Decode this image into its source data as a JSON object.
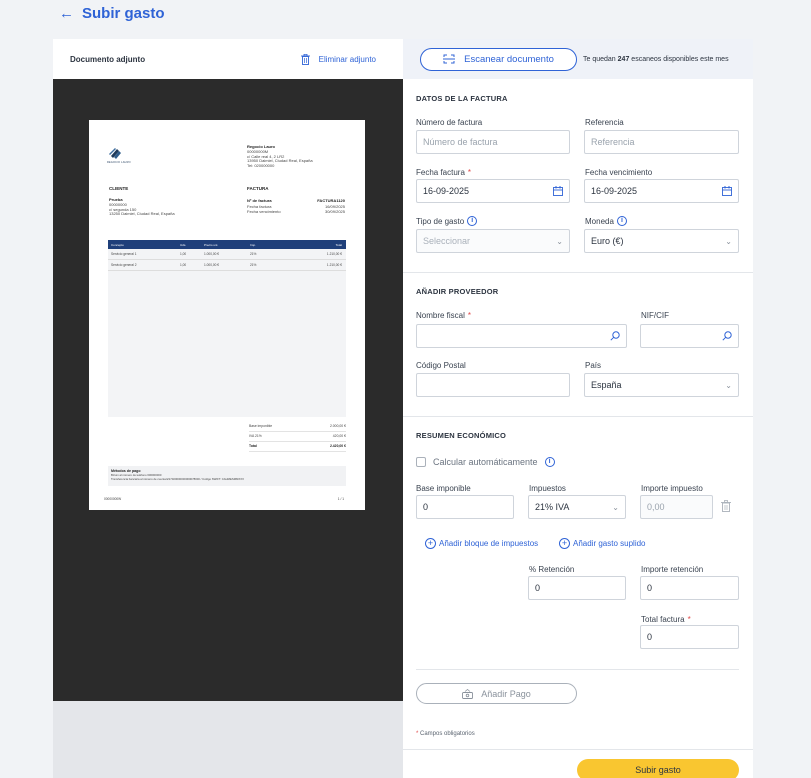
{
  "header": {
    "back_arrow": "←",
    "title": "Subir gasto"
  },
  "left": {
    "doc_label": "Documento adjunto",
    "remove_label": "Eliminar adjunto",
    "pdf": {
      "logo_text": "REGOCIO LAURO",
      "company_name": "Regocio Lauro",
      "company_lines": [
        "00000000M",
        "c/ Calle real 4, 2 LR2",
        "13950 Daimiel, Ciudad Real, España",
        "Tel: 020000000"
      ],
      "client_heading": "CLIENTE",
      "client_name": "Prueba",
      "client_lines": [
        "00000000",
        "c/ segunda 150",
        "13250 Daimiel, Ciudad Real, España"
      ],
      "invoice_heading": "FACTURA",
      "invoice_rows": [
        {
          "k": "Nº de factura",
          "v": "FACTURA1120"
        },
        {
          "k": "Fecha factura",
          "v": "16/09/2025"
        },
        {
          "k": "Fecha vencimiento",
          "v": "30/09/2025"
        }
      ],
      "table_headers": [
        "Concepto",
        "Uds.",
        "Precio uni.",
        "Imp.",
        "Total"
      ],
      "table_rows": [
        [
          "Servicio general 1",
          "1,00",
          "1.000,00 €",
          "21%",
          "1.210,00 €"
        ],
        [
          "Servicio general 2",
          "1,00",
          "1.000,00 €",
          "21%",
          "1.210,00 €"
        ]
      ],
      "totals": [
        {
          "k": "Base imponible",
          "v": "2.000,00 €"
        },
        {
          "k": "IVA 21%",
          "v": "420,00 €"
        },
        {
          "k": "Total",
          "v": "2.420,00 €"
        }
      ],
      "pay_title": "Métodos de pago",
      "pay_line1": "Bizum al número de teléfono 600000000",
      "pay_line2": "Transferencia bancaria al número de cuenta ES7400000000000078000 / Código SWIFT: CAHMESMMXXX",
      "footer_left": "00000000W",
      "footer_right": "1 / 1"
    }
  },
  "right": {
    "scan_label": "Escanear documento",
    "scan_info_pre": "Te quedan",
    "scan_count": "247",
    "scan_info_post": "escaneos disponibles este mes",
    "invoice_section": {
      "title": "DATOS DE LA FACTURA",
      "invoice_number_label": "Número de factura",
      "invoice_number_placeholder": "Número de factura",
      "reference_label": "Referencia",
      "reference_placeholder": "Referencia",
      "invoice_date_label": "Fecha factura",
      "invoice_date_value": "16-09-2025",
      "due_date_label": "Fecha vencimiento",
      "due_date_value": "16-09-2025",
      "expense_type_label": "Tipo de gasto",
      "expense_type_value": "Seleccionar",
      "currency_label": "Moneda",
      "currency_value": "Euro (€)"
    },
    "supplier_section": {
      "title": "AÑADIR PROVEEDOR",
      "fiscal_name_label": "Nombre fiscal",
      "nif_label": "NIF/CIF",
      "postal_code_label": "Código Postal",
      "country_label": "País",
      "country_value": "España"
    },
    "summary_section": {
      "title": "RESUMEN ECONÓMICO",
      "auto_calc_label": "Calcular automáticamente",
      "base_label": "Base imponible",
      "base_value": "0",
      "taxes_label": "Impuestos",
      "taxes_value": "21% IVA",
      "tax_amount_label": "Importe impuesto",
      "tax_amount_placeholder": "0,00",
      "add_tax_block_label": "Añadir bloque de impuestos",
      "add_supplied_label": "Añadir gasto suplido",
      "retention_pct_label": "% Retención",
      "retention_pct_value": "0",
      "retention_amount_label": "Importe retención",
      "retention_amount_value": "0",
      "total_label": "Total factura",
      "total_value": "0"
    },
    "add_payment_label": "Añadir Pago",
    "required_note": "Campos obligatorios",
    "required_mark": "*",
    "submit_label": "Subir gasto"
  },
  "colors": {
    "accent": "#2f63d6",
    "submit": "#f9c630",
    "required": "#e04848",
    "viewer_bg": "#2b2b2b"
  }
}
